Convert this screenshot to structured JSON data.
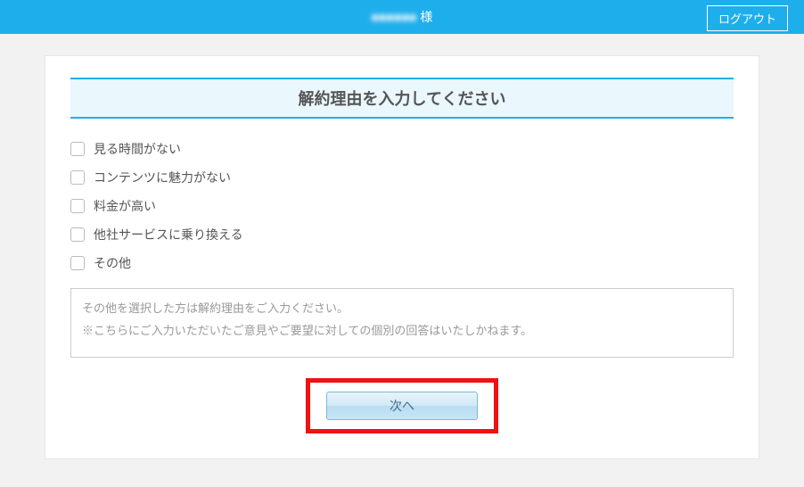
{
  "header": {
    "user_name": "■■■■■■",
    "user_suffix": "様",
    "logout_label": "ログアウト"
  },
  "form": {
    "title": "解約理由を入力してください",
    "options": [
      {
        "label": "見る時間がない"
      },
      {
        "label": "コンテンツに魅力がない"
      },
      {
        "label": "料金が高い"
      },
      {
        "label": "他社サービスに乗り換える"
      },
      {
        "label": "その他"
      }
    ],
    "textarea_placeholder": "その他を選択した方は解約理由をご入力ください。\n※こちらにご入力いただいたご意見やご要望に対しての個別の回答はいたしかねます。",
    "next_label": "次へ"
  }
}
